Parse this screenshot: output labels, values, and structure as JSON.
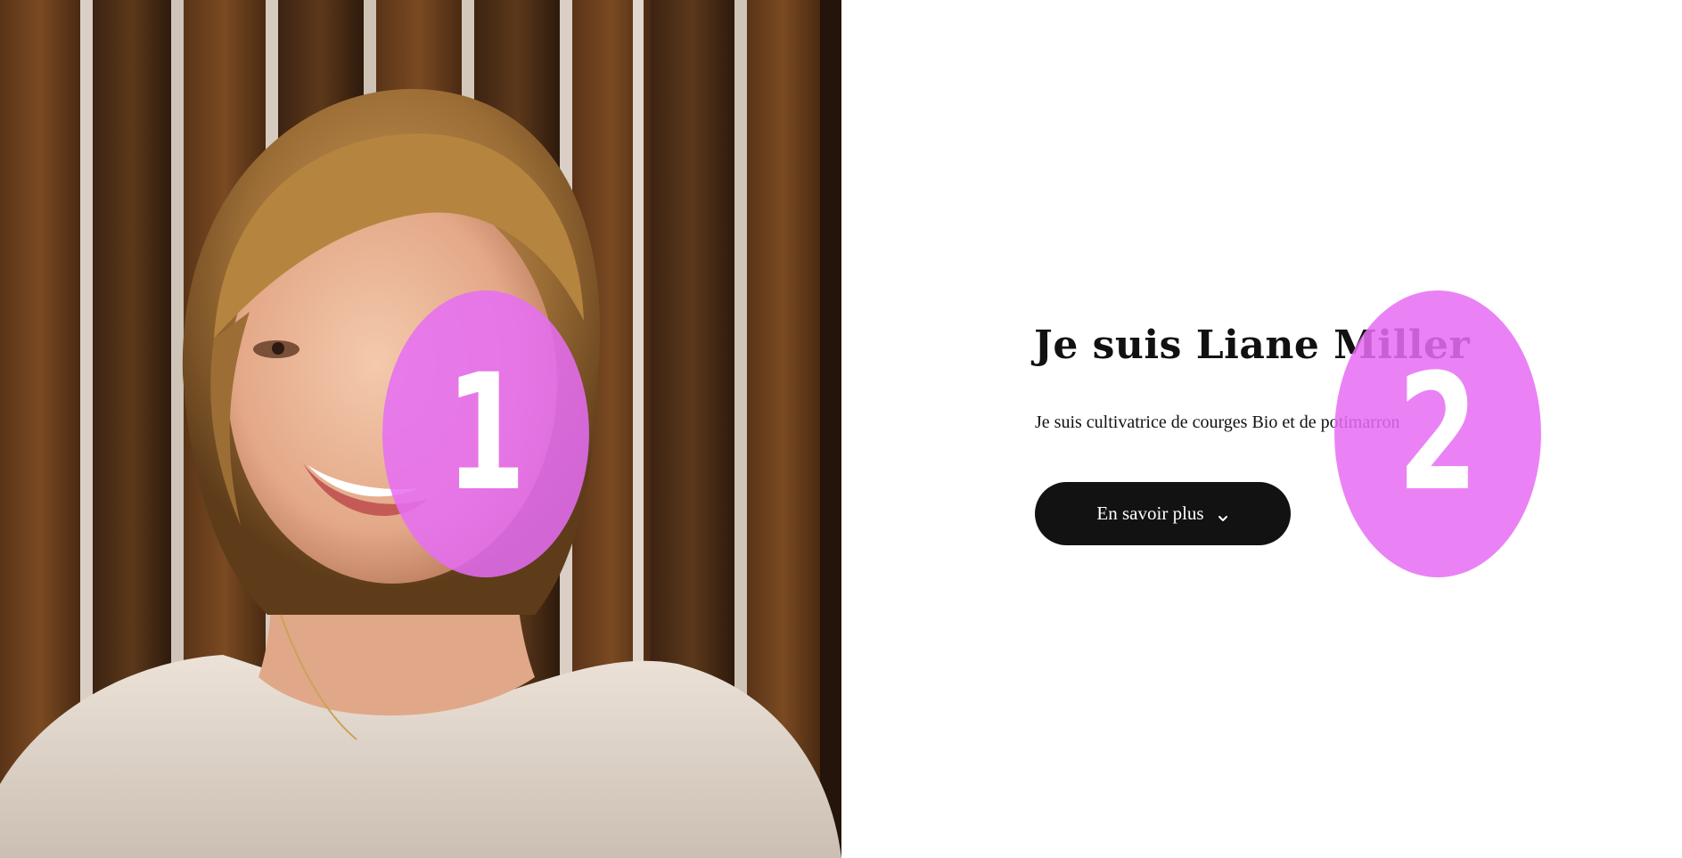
{
  "hero": {
    "title": "Je suis Liane Miller",
    "subtitle": "Je suis cultivatrice de courges Bio et de potimarron",
    "cta_label": "En savoir plus"
  },
  "markers": {
    "first": "1",
    "second": "2"
  },
  "icons": {
    "cta": "chevron-down-icon"
  },
  "colors": {
    "button_bg": "#121212",
    "button_text": "#ffffff",
    "marker": "#e66ef5",
    "text": "#111111"
  }
}
